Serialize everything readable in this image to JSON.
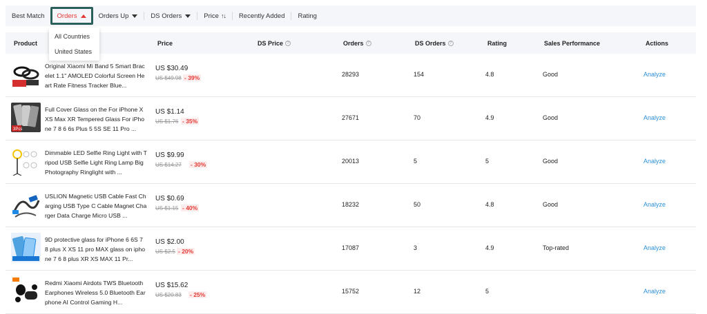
{
  "sort_bar": {
    "items": [
      {
        "label": "Best Match"
      },
      {
        "label": "Orders"
      },
      {
        "label": "Orders Up"
      },
      {
        "label": "DS Orders"
      },
      {
        "label": "Price"
      },
      {
        "label": "Recently Added"
      },
      {
        "label": "Rating"
      }
    ],
    "active": "Orders"
  },
  "orders_dropdown": {
    "options": [
      "All Countries",
      "United States"
    ]
  },
  "table": {
    "headers": [
      "Product",
      "Price",
      "DS Price",
      "Orders",
      "DS Orders",
      "Rating",
      "Sales Performance",
      "Actions"
    ],
    "rows": [
      {
        "title": "Original Xiaomi Mi Band 5 Smart Bracelet 1.1\" AMOLED Colorful Screen Heart Rate Fitness Tracker Blue...",
        "price": "US $30.49",
        "old_price": "US $49.98",
        "discount": "- 39%",
        "orders": "28293",
        "ds_orders": "154",
        "rating": "4.8",
        "performance": "Good",
        "action": "Analyze"
      },
      {
        "title": "Full Cover Glass on the For iPhone X XS Max XR Tempered Glass For iPhone 7 8 6 6s Plus 5 5S SE 11 Pro ...",
        "price": "US $1.14",
        "old_price": "US $1.76",
        "discount": "- 35%",
        "orders": "27671",
        "ds_orders": "70",
        "rating": "4.9",
        "performance": "Good",
        "action": "Analyze"
      },
      {
        "title": "Dimmable LED Selfie Ring Light with Tripod USB Selfie Light Ring Lamp Big Photography Ringlight with ...",
        "price": "US $9.99",
        "old_price": "US $14.27",
        "discount": "- 30%",
        "orders": "20013",
        "ds_orders": "5",
        "rating": "5",
        "performance": "Good",
        "action": "Analyze"
      },
      {
        "title": "USLION Magnetic USB Cable Fast Charging USB Type C Cable Magnet Charger Data Charge Micro USB ...",
        "price": "US $0.69",
        "old_price": "US $1.15",
        "discount": "- 40%",
        "orders": "18232",
        "ds_orders": "50",
        "rating": "4.8",
        "performance": "Good",
        "action": "Analyze"
      },
      {
        "title": "9D protective glass for iPhone 6 6S 7 8 plus X XS 11 pro MAX glass on iphone 7 6 8 plus XR XS MAX 11 Pr...",
        "price": "US $2.00",
        "old_price": "US $2.5",
        "discount": "- 20%",
        "orders": "17087",
        "ds_orders": "3",
        "rating": "4.9",
        "performance": "Top-rated",
        "action": "Analyze"
      },
      {
        "title": "Redmi Xiaomi Airdots TWS Bluetooth Earphones Wireless 5.0 Bluetooth Earphone AI Control Gaming H...",
        "price": "US $15.62",
        "old_price": "US $20.83",
        "discount": "- 25%",
        "orders": "15752",
        "ds_orders": "12",
        "rating": "5",
        "performance": "",
        "action": "Analyze"
      }
    ]
  },
  "colors": {
    "accent_red": "#e53935",
    "link_blue": "#2a8fd6",
    "highlight_border": "#2a5f5a",
    "header_bg": "#f4f6f9"
  }
}
